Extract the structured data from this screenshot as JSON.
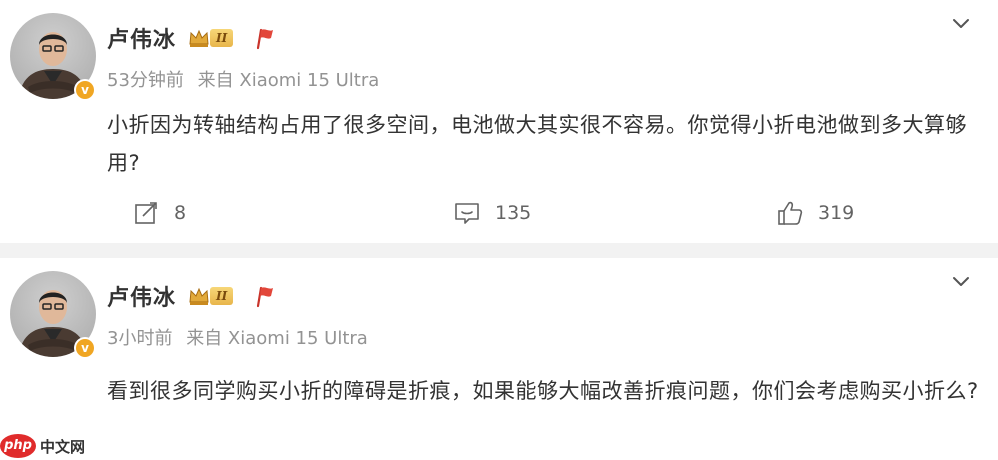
{
  "posts": [
    {
      "author": "卢伟冰",
      "vip_level": "II",
      "time": "53分钟前",
      "source": "来自 Xiaomi 15 Ultra",
      "text": "小折因为转轴结构占用了很多空间，电池做大其实很不容易。你觉得小折电池做到多大算够用?",
      "reposts": "8",
      "comments": "135",
      "likes": "319"
    },
    {
      "author": "卢伟冰",
      "vip_level": "II",
      "time": "3小时前",
      "source": "来自 Xiaomi 15 Ultra",
      "text": "看到很多同学购买小折的障碍是折痕，如果能够大幅改善折痕问题，你们会考虑购买小折么?"
    }
  ],
  "icons": {
    "verified": "verified-v-badge",
    "crown": "crown-icon",
    "flag": "red-flag-icon",
    "more": "chevron-down-icon",
    "repost": "repost-icon",
    "comment": "comment-icon",
    "like": "like-icon"
  },
  "watermark": {
    "badge": "php",
    "text": "中文网"
  },
  "colors": {
    "text_primary": "#333333",
    "text_secondary": "#939393",
    "verified_orange": "#f0a623",
    "watermark_red": "#e02b2b"
  }
}
